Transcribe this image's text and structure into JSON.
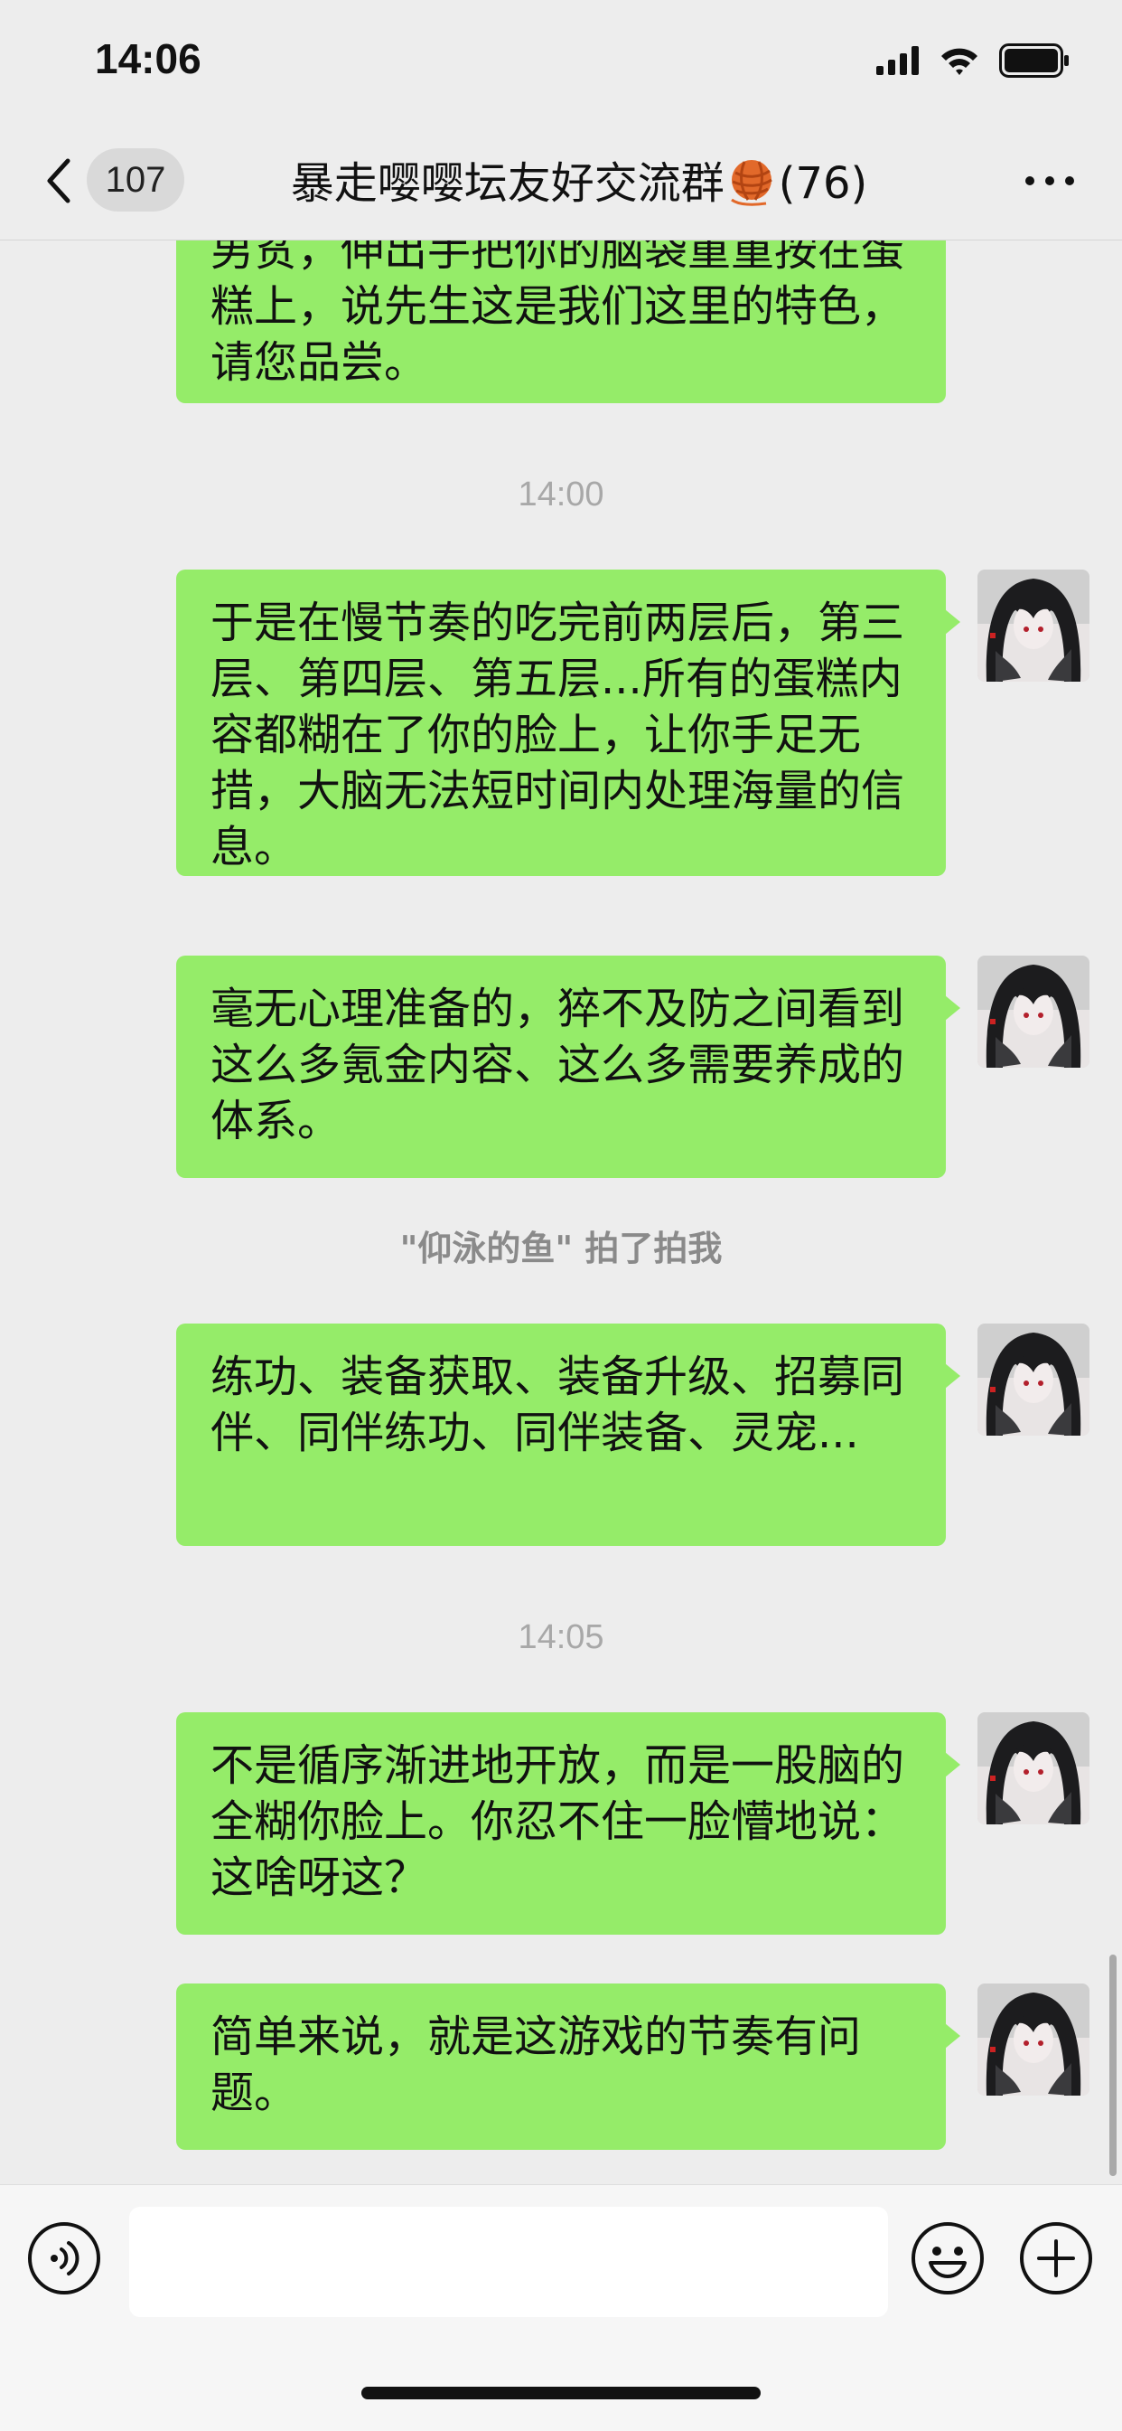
{
  "status_bar": {
    "time": "14:06",
    "icons": [
      "signal-icon",
      "wifi-icon",
      "battery-icon"
    ]
  },
  "nav": {
    "unread_count": "107",
    "title": "暴走嘤嘤坛友好交流群",
    "title_emoji": "yarn-ball-icon",
    "member_count": "(76)",
    "icons": [
      "back-chevron-icon",
      "more-dots-icon"
    ]
  },
  "messages": [
    {
      "type": "text",
      "clipped": true,
      "text": "男贫，伸出手把你的脑袋重重按在蛋糕上，说先生这是我们这里的特色，请您品尝。"
    },
    {
      "type": "time",
      "text": "14:00"
    },
    {
      "type": "text",
      "text": "于是在慢节奏的吃完前两层后，第三层、第四层、第五层...所有的蛋糕内容都糊在了你的脸上，让你手足无措，大脑无法短时间内处理海量的信息。"
    },
    {
      "type": "text",
      "text": "毫无心理准备的，猝不及防之间看到这么多氪金内容、这么多需要养成的体系。"
    },
    {
      "type": "system",
      "text": "\"仰泳的鱼\" 拍了拍我"
    },
    {
      "type": "text",
      "text": "练功、装备获取、装备升级、招募同伴、同伴练功、同伴装备、灵宠..."
    },
    {
      "type": "time",
      "text": "14:05"
    },
    {
      "type": "text",
      "text": "不是循序渐进地开放，而是一股脑的全糊你脸上。你忍不住一脸懵地说：这啥呀这？"
    },
    {
      "type": "text",
      "text": "简单来说，就是这游戏的节奏有问题。"
    }
  ],
  "input_bar": {
    "placeholder": "",
    "icons": [
      "voice-icon",
      "emoji-icon",
      "plus-icon"
    ]
  },
  "colors": {
    "bubble_green": "#95ec69",
    "background": "#ededed",
    "input_bar_bg": "#f6f6f6"
  }
}
